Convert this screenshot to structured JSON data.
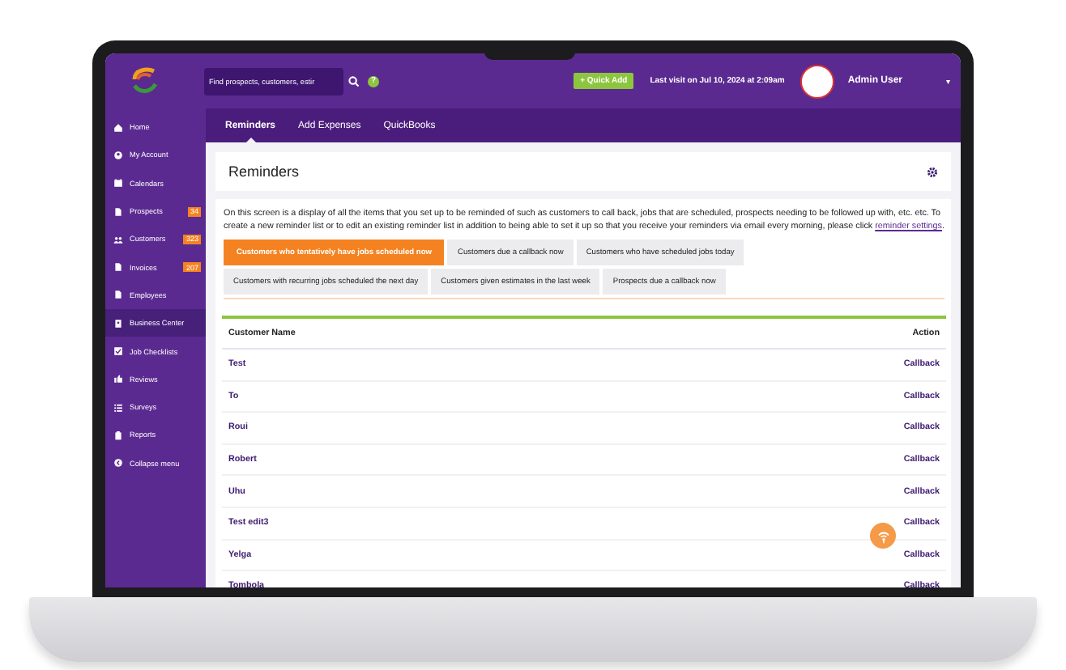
{
  "topbar": {
    "search": {
      "placeholder": "Find prospects, customers, estir"
    },
    "help": "?",
    "quick_add": "+ Quick Add",
    "last_visit": "Last visit on Jul 10, 2024 at 2:09am",
    "user": "Admin User",
    "user_caret": "▾"
  },
  "sidebar": {
    "items": [
      {
        "label": "Home",
        "selected": false
      },
      {
        "label": "My Account",
        "selected": false
      },
      {
        "label": "Calendars",
        "selected": false
      },
      {
        "label": "Prospects",
        "selected": false,
        "badge": "34"
      },
      {
        "label": "Customers",
        "selected": false,
        "badge": "323"
      },
      {
        "label": "Invoices",
        "selected": false,
        "badge": "207"
      },
      {
        "label": "Employees",
        "selected": false
      },
      {
        "label": "Business Center",
        "selected": true
      },
      {
        "label": "Job Checklists",
        "selected": false
      },
      {
        "label": "Reviews",
        "selected": false
      },
      {
        "label": "Surveys",
        "selected": false
      },
      {
        "label": "Reports",
        "selected": false
      },
      {
        "label": "Collapse menu",
        "selected": false
      }
    ]
  },
  "tabs": [
    {
      "label": "Reminders",
      "selected": true
    },
    {
      "label": "Add Expenses",
      "selected": false
    },
    {
      "label": "QuickBooks",
      "selected": false
    }
  ],
  "page_title": "Reminders",
  "intro": {
    "text": "On this screen is a display of all the items that you set up to be reminded of such as customers to call back, jobs that are scheduled, prospects needing to be followed up with, etc. etc. To create a new reminder list or to edit an existing reminder list in addition to being able to set it up so that you receive your reminders via email every morning, please click ",
    "link": "reminder settings",
    "after": "."
  },
  "filters": [
    {
      "label": "Customers who tentatively have jobs scheduled now",
      "selected": true
    },
    {
      "label": "Customers due a callback now",
      "selected": false
    },
    {
      "label": "Customers who have scheduled jobs today",
      "selected": false
    },
    {
      "label": "Customers with recurring jobs scheduled the next day",
      "selected": false
    },
    {
      "label": "Customers given estimates in the last week",
      "selected": false
    },
    {
      "label": "Prospects due a callback now",
      "selected": false
    }
  ],
  "table": {
    "columns": [
      "Customer Name",
      "Action"
    ],
    "rows": [
      [
        "Test",
        "Callback"
      ],
      [
        "To",
        "Callback"
      ],
      [
        "Roui",
        "Callback"
      ],
      [
        "Robert",
        "Callback"
      ],
      [
        "Uhu",
        "Callback"
      ],
      [
        "Test edit3",
        "Callback"
      ],
      [
        "Yelga",
        "Callback"
      ],
      [
        "Tombola",
        "Callback"
      ]
    ]
  }
}
